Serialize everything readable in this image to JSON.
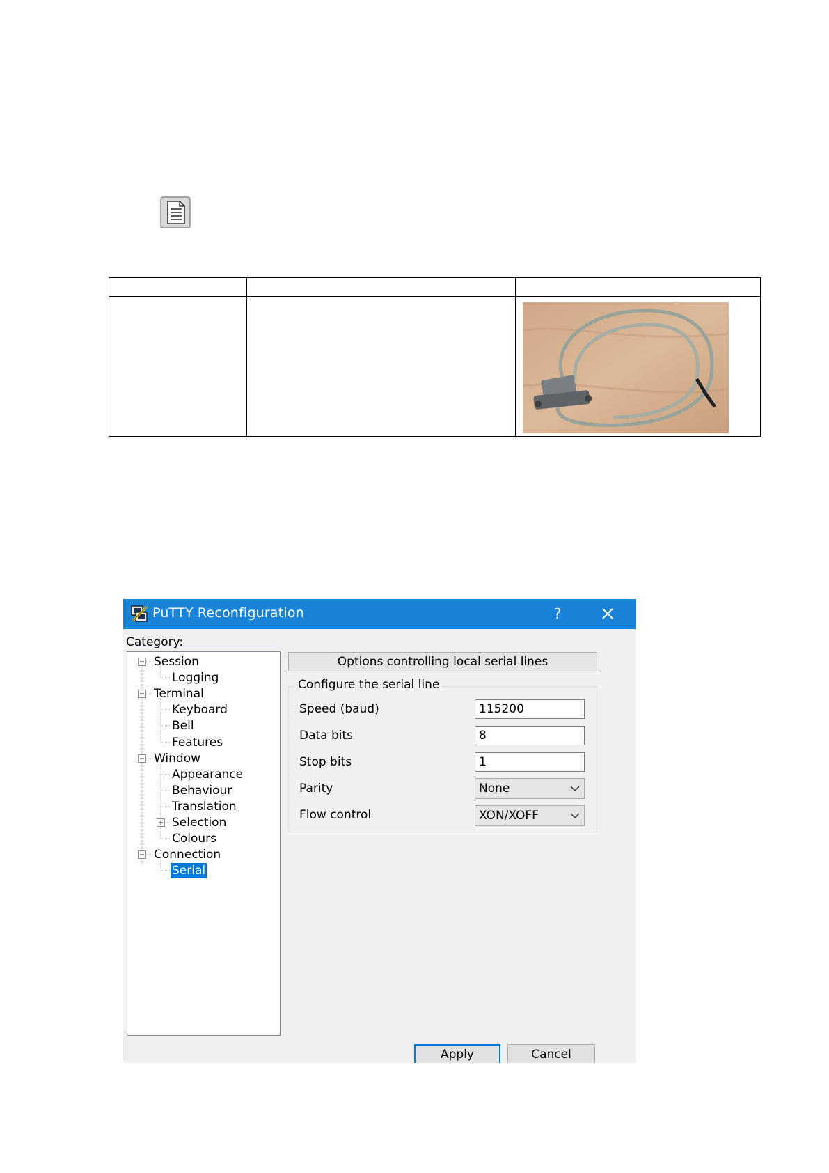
{
  "dialog": {
    "title": "PuTTY Reconfiguration",
    "help_label": "?",
    "category_label": "Category:",
    "tree": [
      {
        "label": "Session"
      },
      {
        "label": "Logging"
      },
      {
        "label": "Terminal"
      },
      {
        "label": "Keyboard"
      },
      {
        "label": "Bell"
      },
      {
        "label": "Features"
      },
      {
        "label": "Window"
      },
      {
        "label": "Appearance"
      },
      {
        "label": "Behaviour"
      },
      {
        "label": "Translation"
      },
      {
        "label": "Selection"
      },
      {
        "label": "Colours"
      },
      {
        "label": "Connection"
      },
      {
        "label": "Serial",
        "selected": true
      }
    ],
    "panel_header": "Options controlling local serial lines",
    "group_title": "Configure the serial line",
    "fields": {
      "speed": {
        "label": "Speed (baud)",
        "value": "115200"
      },
      "data_bits": {
        "label": "Data bits",
        "value": "8"
      },
      "stop_bits": {
        "label": "Stop bits",
        "value": "1"
      },
      "parity": {
        "label": "Parity",
        "value": "None"
      },
      "flow_control": {
        "label": "Flow control",
        "value": "XON/XOFF"
      }
    },
    "buttons": {
      "apply": "Apply",
      "cancel": "Cancel"
    }
  },
  "colors": {
    "titlebar": "#1883d7",
    "selection": "#0078d7",
    "dialog_bg": "#f0f0f0"
  }
}
